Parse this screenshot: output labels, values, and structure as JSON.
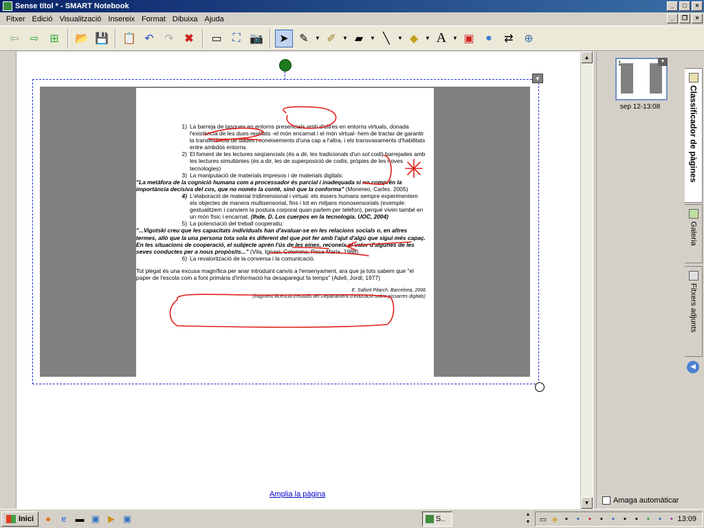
{
  "window": {
    "title": "Sense títol * - SMART Notebook"
  },
  "menu": [
    "Fitxer",
    "Edició",
    "Visualització",
    "Insereix",
    "Format",
    "Dibuixa",
    "Ajuda"
  ],
  "workspace": {
    "expand_link": "Amplia la pàgina"
  },
  "doc": {
    "item1": {
      "num": "1)",
      "text": "La barreja de tasques en entorns presencials amb d'altres en entorns virtuals, donada l'existència de les dues realitats -el món encarnat i el món virtual- hem de tractar de garantir la transferència de dades i coneixements d'una cap a l'altra, i els transvasaments d'habilitats entre ambdós entorns."
    },
    "item2": {
      "num": "2)",
      "text": "El foment de les lectures seqüencials (és a dir, les tradicionals d'un sol codi) barrejades amb les lectures simultànies (és a dir, les de superposició de codis, pròpies de les noves tecnologies)"
    },
    "item3": {
      "num": "3)",
      "text": "La manipulació de materials impresos i de materials digitals:"
    },
    "quote1": {
      "text": "\"La metàfora de la cognició humana com a processador és parcial i inadequada si no comprèn la importància decisiva del cos, que no només la conté, sinó que la conforma\"",
      "cite": " (Monereo, Carles. 2005)"
    },
    "item4": {
      "num": "4)",
      "text": "L'elaboració de material tridimensional i virtual: els éssers humans sempre experimentem els objectes de manera multisensorial, fins i tot en mitjans monosensorials (exemple: gestualitzem i canviem la postura corporal quan parlem per telèfon), perquè vivim també en un món físic i encarnat.",
      "cite": " (Ihde, D. Los cuerpos en la tecnología. UOC, 2004)"
    },
    "item5": {
      "num": "5)",
      "text": "La potenciació del treball cooperatiu:"
    },
    "quote2": {
      "text": "\"...Vigotski creu que les capacitats individuals han d'avaluar-se en les relacions socials o, en altres termes, allò que la una persona tota sola és diferent del que pot fer amb l'ajut d'algú que sigui més capaç. En les situacions de cooperació, el subjecte aprèn l'ús de les eines, reconeix el valor d'algunes de les seves conductes per a nous propòsits...\"",
      "cite": " (Vila, Ignasi; Colomina, Rosa Maria, 1988)"
    },
    "item6": {
      "num": "6)",
      "text": "La revalorització de la conversa i la comunicació."
    },
    "closing": {
      "text": "Tot plegat és una excusa magnífica per anar introduint canvis a l'ensenyament, ara que ja tots sabem que \"el paper de l'escola com a font primària d'informació ha desaparegut fa temps\"",
      "cite": " (Adell, Jordi; 1977)"
    },
    "sig1": "E. Saforit Pitarch. Barcelona, 2006",
    "sig2": "(fragment llicència d'estudis del Departament d'Educació sobre pissarres digitals)"
  },
  "sidebar": {
    "thumb_num": "1",
    "thumb_label": "sep 12-13:08",
    "autohide_label": "Amaga automàticar",
    "tabs": [
      "Classificador de pàgines",
      "Galeria",
      "Fitxers adjunts"
    ]
  },
  "taskbar": {
    "start": "Inici",
    "task_label": "S..",
    "clock": "13:09"
  },
  "colors": {
    "annotation_red": "#e0201a",
    "title_blue": "#0a246a",
    "selection_blue": "#2030d0"
  }
}
